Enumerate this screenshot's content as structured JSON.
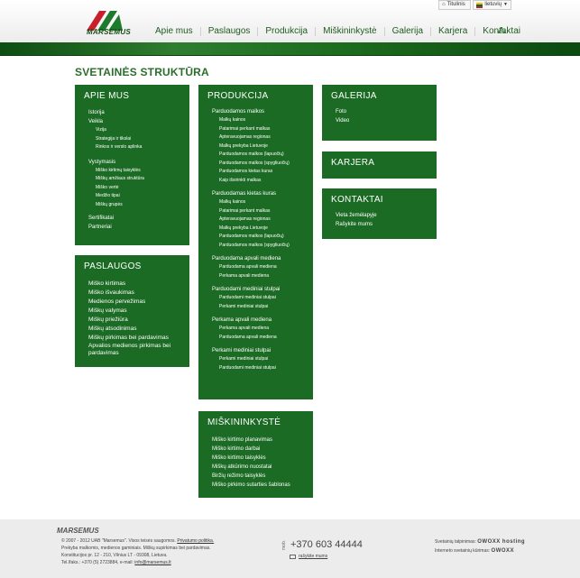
{
  "header": {
    "logo_text": "MARSEMUS",
    "home_label": "Titulinis",
    "lang_label": "lietuvių",
    "nav": [
      "Apie mus",
      "Paslaugos",
      "Produkcija",
      "Miškininkystė",
      "Galerija",
      "Karjera",
      "Kontaktai"
    ]
  },
  "page_title": "SVETAINĖS STRUKTŪRA",
  "apie": {
    "title": "APIE MUS",
    "items": {
      "a": "Istorija",
      "b": "Veikla",
      "b1": "Vizija",
      "b2": "Strategija ir tikslai",
      "b3": "Rinkos ir verslo aplinka",
      "c": "Vystymasis",
      "c1": "Miško kirtimų taisyklės",
      "c2": "Miškų amžiaus struktūra",
      "c3": "Miško vertė",
      "c4": "Medžio tipai",
      "c5": "Miškų grupės",
      "d": "Sertifikatai",
      "e": "Partneriai"
    }
  },
  "paslaugos": {
    "title": "PASLAUGOS",
    "items": [
      "Miško kirtimas",
      "Miško išvaukimas",
      "Medienos pervežimas",
      "Miškų valymas",
      "Miškų priežiūra",
      "Miškų atsodinimas",
      "Miškų pirkimas bei pardavimas",
      "Apvalios medienos pirkimas bei pardavimas"
    ]
  },
  "produkcija": {
    "title": "PRODUKCIJA",
    "g1": {
      "head": "Parduodamos malkos",
      "items": [
        "Malkų kainos",
        "Patarimai perkant malkas",
        "Apteravuojamas regionas",
        "Malkų prekyba Lietuvoje",
        "Parduodamos malkos (lapuočių)",
        "Parduodamos malkos (spygliuočių)",
        "Parduodamos kietas kuras",
        "Kaip išsirinkti malkas"
      ]
    },
    "g2": {
      "head": "Parduodamas kietas kuras",
      "items": [
        "Malkų kainos",
        "Patarimai perkant malkas",
        "Apteravuojamas regionas",
        "Malkų prekyba Lietuvoje",
        "Parduodamos malkos (lapuočių)",
        "Parduodamos malkos (spygliuočių)"
      ]
    },
    "g3": {
      "head": "Parduodama apvali mediena",
      "items": [
        "Parduodama apvali mediena",
        "Perkama apvali mediena"
      ]
    },
    "g4": {
      "head": "Parduodami mediniai stulpai",
      "items": [
        "Parduodami mediniai stulpai",
        "Perkami mediniai stulpai"
      ]
    },
    "g5": {
      "head": "Perkama apvali mediena",
      "items": [
        "Perkama apvali mediena",
        "Parduodama apvali mediena"
      ]
    },
    "g6": {
      "head": "Perkami mediniai stulpai",
      "items": [
        "Perkami mediniai stulpai",
        "Parduodami mediniai stulpai"
      ]
    }
  },
  "miskininkyste": {
    "title": "MIŠKININKYSTĖ",
    "items": [
      "Miško kirtimo planavimas",
      "Miško kirtimo darbai",
      "Miško kirtimo taisyklės",
      "Miškų atkūrimo nuostatai",
      "Biržių režimo taisyklės",
      "Miško pirkimo sutarties šablonas"
    ]
  },
  "galerija": {
    "title": "GALERIJA",
    "items": [
      "Foto",
      "Video"
    ]
  },
  "karjera": {
    "title": "KARJERA"
  },
  "kontaktai": {
    "title": "KONTAKTAI",
    "items": [
      "Vieta žemėlapyje",
      "Rašykite mums"
    ]
  },
  "footer": {
    "logo": "MARSEMUS",
    "line1": "© 2007 - 2012 UAB \"Marsemus\". Visos teisės saugomos.",
    "privacy": "Privatumo politika.",
    "line2": "Prekyba malkomis, medienos gaminiais. Miškų supirkimas bei pardavimas.",
    "line3": "Konstitucijos pr. 12 - 210, Vilnius LT - 09308, Lietuva.",
    "line4": "Tel./faks.: +370 (5) 2723884, e-mail:",
    "email": "info@marsemus.lt",
    "phone_label": "mob.",
    "phone": "+370 603 44444",
    "write_us": "rašykite mums",
    "hosting_label": "Svetainių talpinimas:",
    "hosting_brand": "OWOXX hosting",
    "creation_label": "Interneto svetainių kūrimas:",
    "creation_brand": "OWOXX"
  }
}
